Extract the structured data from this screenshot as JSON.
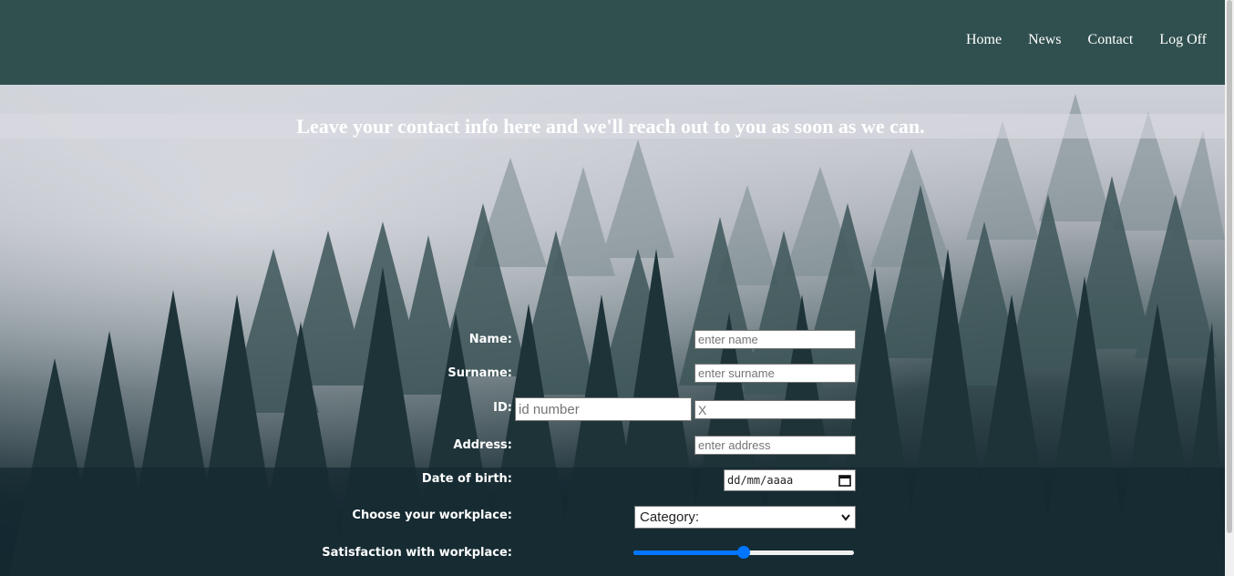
{
  "nav": {
    "items": [
      {
        "label": "Home"
      },
      {
        "label": "News"
      },
      {
        "label": "Contact"
      },
      {
        "label": "Log Off"
      }
    ]
  },
  "banner": {
    "text": "Leave your contact info here and we'll reach out to you as soon as we can."
  },
  "form": {
    "name": {
      "label": "Name:",
      "placeholder": "enter name"
    },
    "surname": {
      "label": "Surname:",
      "placeholder": "enter surname"
    },
    "id": {
      "label": "ID:",
      "placeholder": "id number",
      "secondary_value": "X"
    },
    "address": {
      "label": "Address:",
      "placeholder": "enter address"
    },
    "dob": {
      "label": "Date of birth:",
      "placeholder": "dd/mm/aaaa"
    },
    "workplace": {
      "label": "Choose your workplace:",
      "selected": "Category:"
    },
    "satisfaction": {
      "label": "Satisfaction with workplace:",
      "value": 0.5
    }
  },
  "colors": {
    "navbar": "#30504f",
    "accent": "#0075ff"
  }
}
